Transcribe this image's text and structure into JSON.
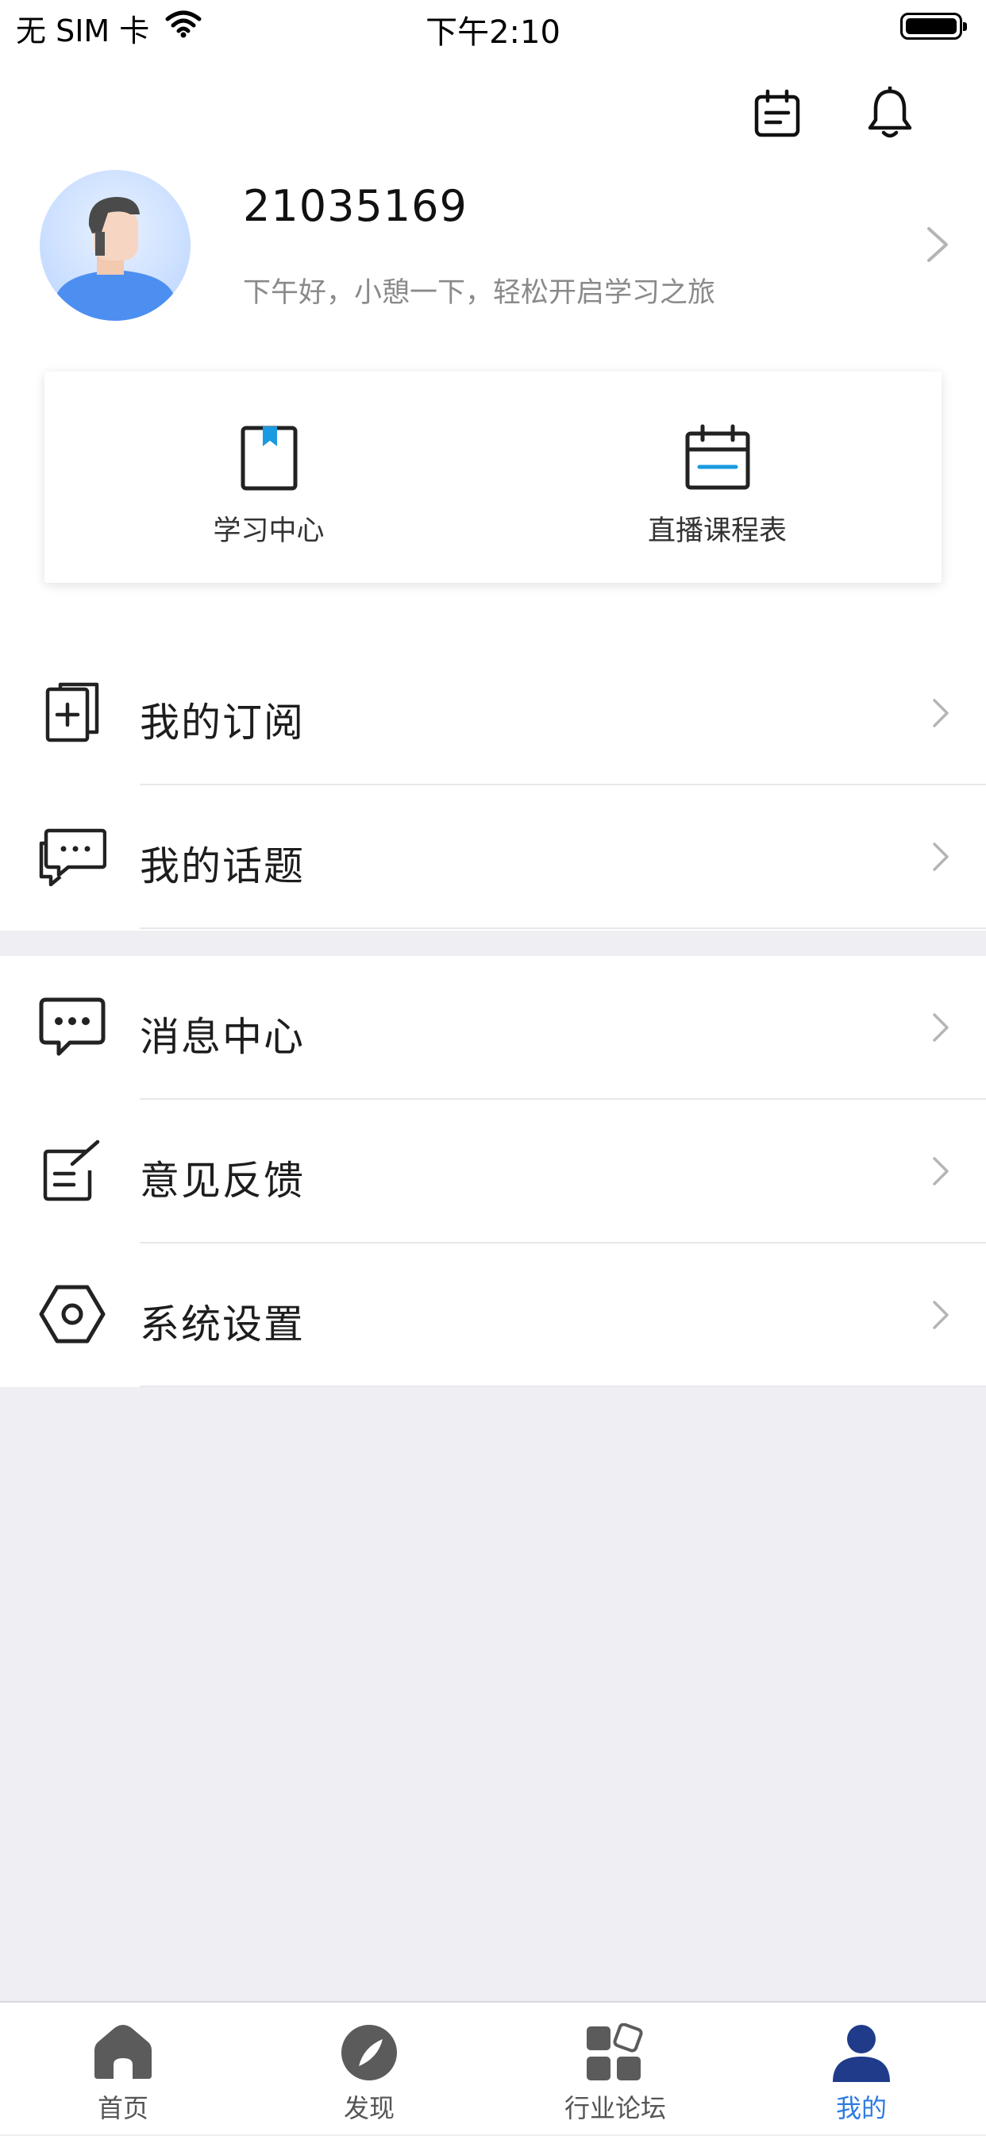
{
  "status_bar": {
    "carrier": "无 SIM 卡",
    "time": "下午2:10"
  },
  "header": {
    "calendar_icon": "calendar-icon",
    "bell_icon": "bell-icon"
  },
  "profile": {
    "username": "21035169",
    "greeting": "下午好，小憩一下，轻松开启学习之旅"
  },
  "quick_card": {
    "items": [
      {
        "label": "学习中心",
        "icon": "bookmark-book-icon"
      },
      {
        "label": "直播课程表",
        "icon": "schedule-icon"
      }
    ]
  },
  "menu_group_1": [
    {
      "label": "我的订阅",
      "icon": "subscribe-icon"
    },
    {
      "label": "我的话题",
      "icon": "topics-icon"
    }
  ],
  "menu_group_2": [
    {
      "label": "消息中心",
      "icon": "message-icon"
    },
    {
      "label": "意见反馈",
      "icon": "feedback-icon"
    },
    {
      "label": "系统设置",
      "icon": "settings-icon"
    }
  ],
  "tabbar": {
    "tabs": [
      {
        "label": "首页",
        "icon": "home-icon"
      },
      {
        "label": "发现",
        "icon": "compass-icon"
      },
      {
        "label": "行业论坛",
        "icon": "forum-icon"
      },
      {
        "label": "我的",
        "icon": "profile-icon",
        "active": true
      }
    ]
  },
  "colors": {
    "accent": "#2f7be0",
    "tab_active_icon": "#1f3b8a",
    "background": "#eeeef3"
  }
}
